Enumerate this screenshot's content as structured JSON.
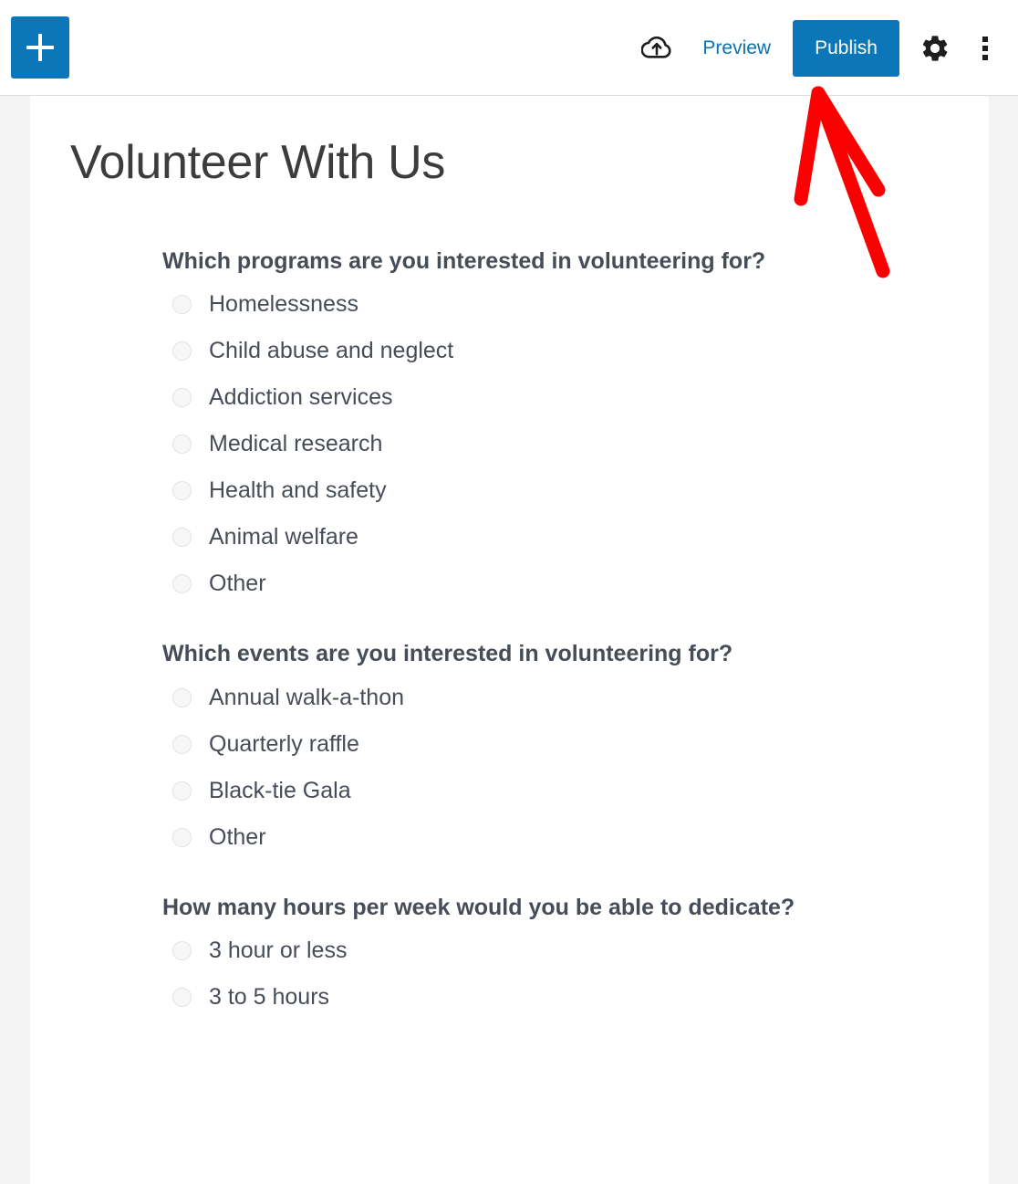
{
  "toolbar": {
    "add_block_label": "+",
    "add_block_icon": "plus-icon",
    "save_draft_icon": "cloud-upload-icon",
    "preview_label": "Preview",
    "publish_label": "Publish",
    "settings_icon": "gear-icon",
    "more_options_icon": "kebab-menu-icon",
    "accent_color": "#0b77b8",
    "preview_link_color": "#0a72b0"
  },
  "editor": {
    "post_title": "Volunteer With Us",
    "questions": [
      {
        "label": "Which programs are you interested in volunteering for?",
        "options": [
          "Homelessness",
          "Child abuse and neglect",
          "Addiction services",
          "Medical research",
          "Health and safety",
          "Animal welfare",
          "Other"
        ]
      },
      {
        "label": "Which events are you interested in volunteering for?",
        "options": [
          "Annual walk-a-thon",
          "Quarterly raffle",
          "Black-tie Gala",
          "Other"
        ]
      },
      {
        "label": "How many hours per week would you be able to dedicate?",
        "options": [
          "3 hour or less",
          "3 to 5 hours"
        ]
      }
    ]
  },
  "annotation": {
    "type": "arrow",
    "color": "#fa0000",
    "points_to": "publish-button"
  }
}
